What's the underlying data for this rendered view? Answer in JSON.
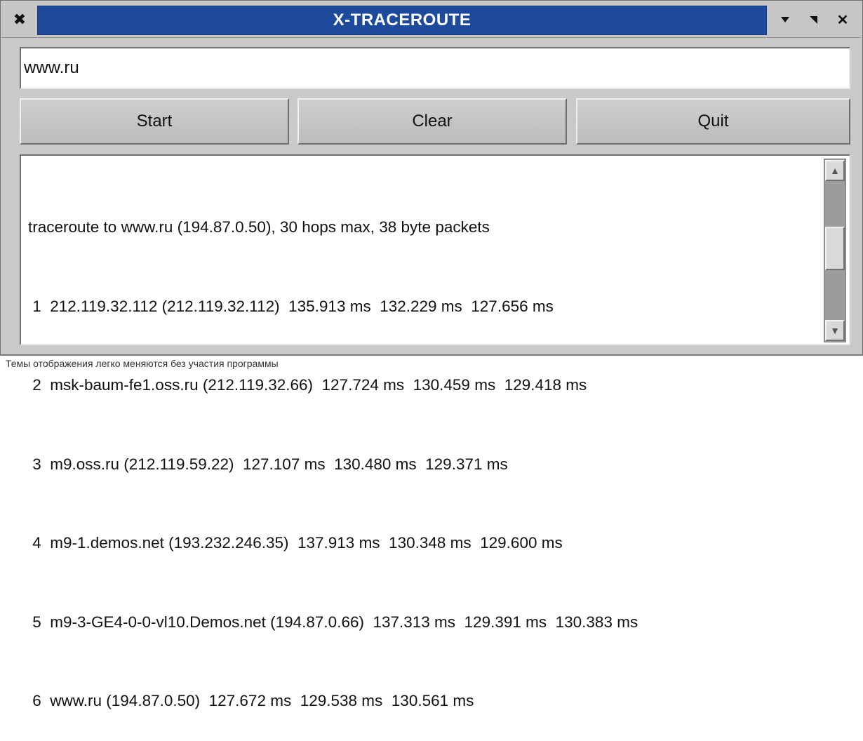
{
  "window": {
    "title": "X-TRACEROUTE",
    "pin_icon": "pin-icon",
    "controls": [
      "minimize-icon",
      "maximize-icon",
      "close-icon"
    ]
  },
  "input": {
    "value": "www.ru"
  },
  "buttons": {
    "start": "Start",
    "clear": "Clear",
    "quit": "Quit"
  },
  "output": {
    "lines": [
      "traceroute to www.ru (194.87.0.50), 30 hops max, 38 byte packets",
      " 1  212.119.32.112 (212.119.32.112)  135.913 ms  132.229 ms  127.656 ms",
      " 2  msk-baum-fe1.oss.ru (212.119.32.66)  127.724 ms  130.459 ms  129.418 ms",
      " 3  m9.oss.ru (212.119.59.22)  127.107 ms  130.480 ms  129.371 ms",
      " 4  m9-1.demos.net (193.232.246.35)  137.913 ms  130.348 ms  129.600 ms",
      " 5  m9-3-GE4-0-0-vl10.Demos.net (194.87.0.66)  137.313 ms  129.391 ms  130.383 ms",
      " 6  www.ru (194.87.0.50)  127.672 ms  129.538 ms  130.561 ms"
    ]
  },
  "caption": "Темы отображения легко меняются без участия программы"
}
